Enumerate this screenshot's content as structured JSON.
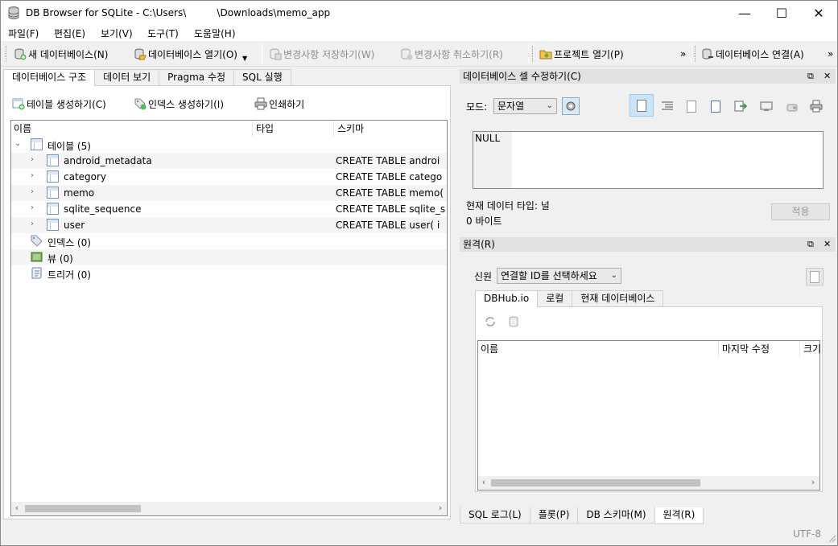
{
  "window": {
    "title": "DB Browser for SQLite - C:\\Users\\          \\Downloads\\memo_app",
    "minimize": "—",
    "maximize": "☐",
    "close": "✕"
  },
  "menu": [
    "파일(F)",
    "편집(E)",
    "보기(V)",
    "도구(T)",
    "도움말(H)"
  ],
  "toolbar": {
    "new_db": "새 데이터베이스(N)",
    "open_db": "데이터베이스 열기(O)",
    "write_changes": "변경사항 저장하기(W)",
    "revert_changes": "변경사항 취소하기(R)",
    "open_project": "프로젝트 열기(P)",
    "attach_db": "데이터베이스 연결(A)",
    "overflow": "»"
  },
  "main_tabs": [
    "데이터베이스 구조",
    "데이터 보기",
    "Pragma 수정",
    "SQL 실행"
  ],
  "structure": {
    "create_table": "테이블 생성하기(C)",
    "create_index": "인덱스 생성하기(I)",
    "print": "인쇄하기",
    "columns": [
      "이름",
      "타입",
      "스키마"
    ],
    "tables_label": "테이블 (5)",
    "tables": [
      {
        "name": "android_metadata",
        "schema": "CREATE TABLE androi"
      },
      {
        "name": "category",
        "schema": "CREATE TABLE catego"
      },
      {
        "name": "memo",
        "schema": "CREATE TABLE memo("
      },
      {
        "name": "sqlite_sequence",
        "schema": "CREATE TABLE sqlite_s"
      },
      {
        "name": "user",
        "schema": "CREATE TABLE user( i"
      }
    ],
    "indices_label": "인덱스 (0)",
    "views_label": "뷰 (0)",
    "triggers_label": "트리거 (0)"
  },
  "edit_cell": {
    "title": "데이터베이스 셀 수정하기(C)",
    "mode_label": "모드:",
    "mode_value": "문자열",
    "cell_value": "NULL",
    "type_text": "현재 데이터 타입: 널",
    "size_text": "0 바이트",
    "apply": "적용"
  },
  "remote": {
    "title": "원격(R)",
    "identity_label": "신원",
    "identity_value": "연결할 ID를 선택하세요",
    "tabs": [
      "DBHub.io",
      "로컬",
      "현재 데이터베이스"
    ],
    "columns": [
      "이름",
      "마지막 수정",
      "크기"
    ]
  },
  "bottom_tabs": [
    "SQL 로그(L)",
    "플롯(P)",
    "DB 스키마(M)",
    "원격(R)"
  ],
  "status": {
    "encoding": "UTF-8"
  },
  "colors": {
    "accent": "#cce4f7",
    "tree_selection_bg": "#f5f5f5"
  }
}
